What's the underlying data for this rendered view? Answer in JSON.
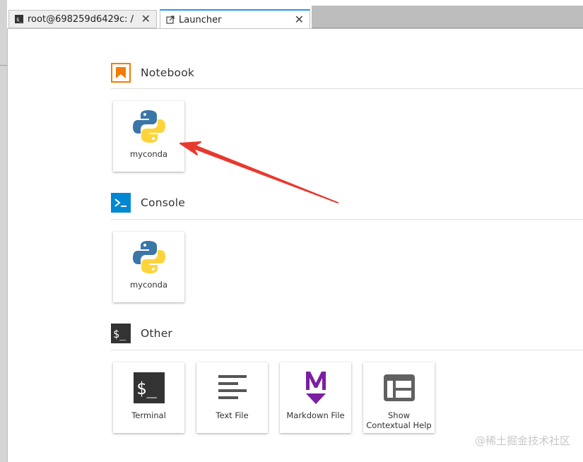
{
  "tabs": [
    {
      "label": "root@698259d6429c: /",
      "icon": "terminal-icon",
      "close": "✕",
      "active": false
    },
    {
      "label": "Launcher",
      "icon": "launcher-icon",
      "close": "✕",
      "active": true
    }
  ],
  "sections": {
    "notebook": {
      "title": "Notebook",
      "icon": "notebook-icon",
      "color": "#f57c00"
    },
    "console": {
      "title": "Console",
      "icon": "console-icon",
      "color": "#0288d1"
    },
    "other": {
      "title": "Other",
      "icon": "other-icon",
      "color": "#333333"
    }
  },
  "cards": {
    "notebook_kernel": {
      "label": "myconda",
      "icon": "python-icon"
    },
    "console_kernel": {
      "label": "myconda",
      "icon": "python-icon"
    },
    "terminal": {
      "label": "Terminal",
      "icon": "terminal-icon"
    },
    "text_file": {
      "label": "Text File",
      "icon": "text-file-icon"
    },
    "markdown_file": {
      "label": "Markdown File",
      "icon": "markdown-icon"
    },
    "contextual_help": {
      "label": "Show Contextual Help",
      "icon": "contextual-help-icon"
    }
  },
  "annotation": {
    "type": "red-arrow",
    "color": "#e8392f"
  },
  "watermark": "@稀土掘金技术社区",
  "colors": {
    "accent": "#2196f3",
    "markdown": "#7b1fa2",
    "python_blue": "#3b76a8",
    "python_yellow": "#ffd43b"
  }
}
